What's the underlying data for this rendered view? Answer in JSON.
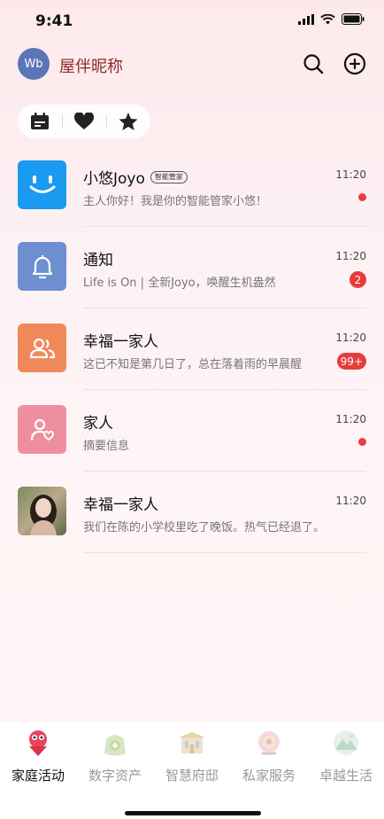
{
  "status": {
    "time": "9:41"
  },
  "header": {
    "avatar_text": "Wb",
    "nickname": "屋伴昵称"
  },
  "filters": [
    "calendar-icon",
    "heart-icon",
    "star-icon"
  ],
  "conversations": [
    {
      "title": "小悠Joyo",
      "tag": "智能管家",
      "time": "11:20",
      "subtitle": "主人你好！我是你的智能管家小悠！",
      "indicator": "dot"
    },
    {
      "title": "通知",
      "time": "11:20",
      "subtitle": "Life is On | 全新Joyo，唤醒生机盎然",
      "badge": "2"
    },
    {
      "title": "幸福一家人",
      "time": "11:20",
      "subtitle": "这已不知是第几日了，总在落着雨的早晨醒",
      "badge": "99+"
    },
    {
      "title": "家人",
      "time": "11:20",
      "subtitle": "摘要信息",
      "indicator": "dot"
    },
    {
      "title": "幸福一家人",
      "time": "11:20",
      "subtitle": "我们在陈的小学校里吃了晚饭。热气已经退了。"
    }
  ],
  "tabs": [
    {
      "label": "家庭活动",
      "active": true
    },
    {
      "label": "数字资产"
    },
    {
      "label": "智慧府邸"
    },
    {
      "label": "私家服务"
    },
    {
      "label": "卓越生活"
    }
  ],
  "colors": {
    "accent_red": "#e83b3b",
    "nickname": "#8c2a2a",
    "joyo_blue": "#1a9bf0",
    "notify_blue": "#6d8fd0",
    "family_orange": "#f0895a",
    "family_pink": "#ee8fa0"
  }
}
